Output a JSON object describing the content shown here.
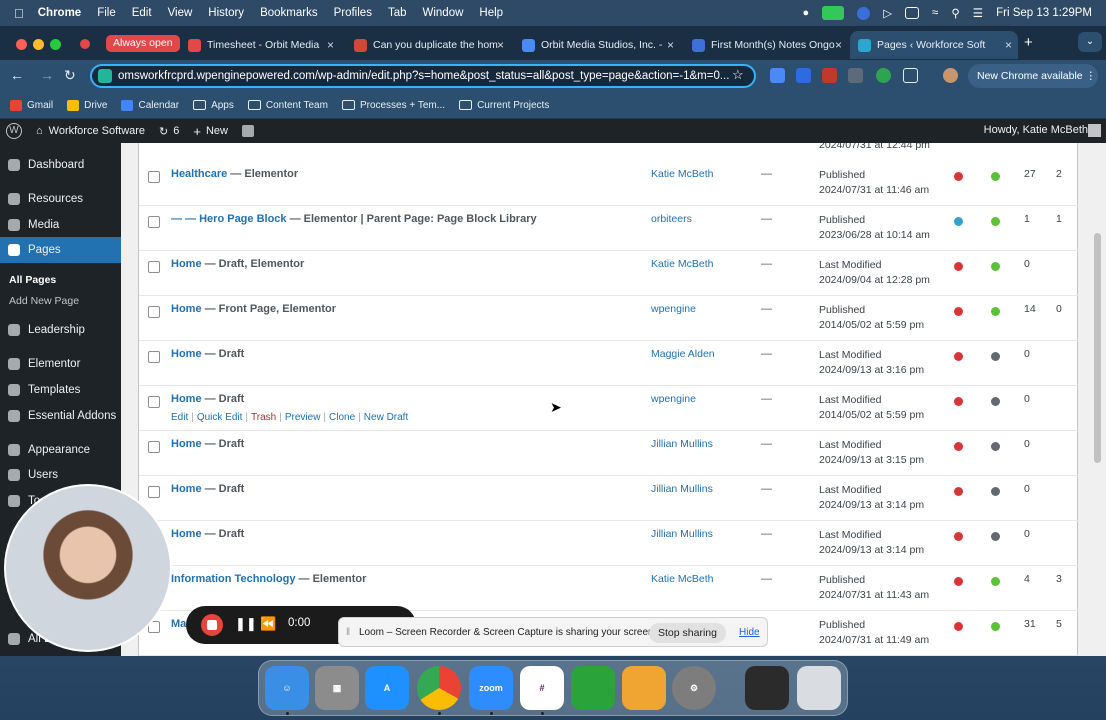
{
  "menubar": {
    "app": "Chrome",
    "items": [
      "File",
      "Edit",
      "View",
      "History",
      "Bookmarks",
      "Profiles",
      "Tab",
      "Window",
      "Help"
    ],
    "clock": "Fri Sep 13  1:29PM"
  },
  "tabs": {
    "pill": "Always open",
    "list": [
      {
        "label": "Timesheet - Orbit Media",
        "color": "#e34848"
      },
      {
        "label": "Can you duplicate the hom",
        "color": "#d44638"
      },
      {
        "label": "Orbit Media Studios, Inc. -",
        "color": "#4a8af4"
      },
      {
        "label": "First Month(s) Notes Ongo",
        "color": "#3f6fd8"
      },
      {
        "label": "Pages ‹ Workforce Soft",
        "color": "#2ba6cf"
      }
    ]
  },
  "toolbar": {
    "url": "omsworkfrcprd.wpenginepowered.com/wp-admin/edit.php?s=home&post_status=all&post_type=page&action=-1&m=0...",
    "new_chrome": "New Chrome available"
  },
  "bookmarks": [
    {
      "label": "Gmail",
      "kind": "icon",
      "color": "#ea4335"
    },
    {
      "label": "Drive",
      "kind": "icon",
      "color": "#fbbc04"
    },
    {
      "label": "Calendar",
      "kind": "icon",
      "color": "#4285f4"
    },
    {
      "label": "Apps",
      "kind": "folder"
    },
    {
      "label": "Content Team",
      "kind": "folder"
    },
    {
      "label": "Processes + Tem...",
      "kind": "folder"
    },
    {
      "label": "Current Projects",
      "kind": "folder"
    }
  ],
  "wpbar": {
    "site": "Workforce Software",
    "updates": "6",
    "new": "New",
    "howdy": "Howdy, Katie McBeth"
  },
  "sidebar": {
    "items": [
      {
        "label": "Dashboard"
      },
      {
        "label": "Resources"
      },
      {
        "label": "Media"
      },
      {
        "label": "Pages"
      },
      {
        "label": "Leadership"
      },
      {
        "label": "Elementor"
      },
      {
        "label": "Templates"
      },
      {
        "label": "Essential Addons"
      },
      {
        "label": "Appearance"
      },
      {
        "label": "Users"
      },
      {
        "label": "To"
      },
      {
        "label": "All E"
      }
    ],
    "sub": [
      "All Pages",
      "Add New Page"
    ]
  },
  "top_date": "2024/07/31 at 12:44 pm",
  "rows": [
    {
      "title": "Healthcare",
      "suffix": " — Elementor",
      "author": "Katie McBeth",
      "comments": "—",
      "status": "Published",
      "date": "2024/07/31 at 11:46 am",
      "c1": "#d63638",
      "c2": "#5bc236",
      "n1": "27",
      "n2": "2"
    },
    {
      "title": "— — Hero Page Block",
      "suffix": " — Elementor | Parent Page: Page Block Library",
      "author": "orbiteers",
      "comments": "—",
      "status": "Published",
      "date": "2023/06/28 at 10:14 am",
      "c1": "#2ea2cc",
      "c2": "#5bc236",
      "n1": "1",
      "n2": "1"
    },
    {
      "title": "Home",
      "suffix": " — Draft, Elementor",
      "author": "Katie McBeth",
      "comments": "—",
      "status": "Last Modified",
      "date": "2024/09/04 at 12:28 pm",
      "c1": "#d63638",
      "c2": "#5bc236",
      "n1": "0",
      "n2": ""
    },
    {
      "title": "Home",
      "suffix": " — Front Page, Elementor",
      "author": "wpengine",
      "comments": "—",
      "status": "Published",
      "date": "2014/05/02 at 5:59 pm",
      "c1": "#d63638",
      "c2": "#5bc236",
      "n1": "14",
      "n2": "0"
    },
    {
      "title": "Home",
      "suffix": " — Draft",
      "author": "Maggie Alden",
      "comments": "—",
      "status": "Last Modified",
      "date": "2024/09/13 at 3:16 pm",
      "c1": "#d63638",
      "c2": "#646970",
      "n1": "0",
      "n2": ""
    },
    {
      "title": "Home",
      "suffix": " — Draft",
      "author": "wpengine",
      "comments": "—",
      "status": "Last Modified",
      "date": "2014/05/02 at 5:59 pm",
      "c1": "#d63638",
      "c2": "#646970",
      "n1": "0",
      "n2": "",
      "actions": [
        "Edit",
        "Quick Edit",
        "Trash",
        "Preview",
        "Clone",
        "New Draft"
      ]
    },
    {
      "title": "Home",
      "suffix": " — Draft",
      "author": "Jillian Mullins",
      "comments": "—",
      "status": "Last Modified",
      "date": "2024/09/13 at 3:15 pm",
      "c1": "#d63638",
      "c2": "#646970",
      "n1": "0",
      "n2": ""
    },
    {
      "title": "Home",
      "suffix": " — Draft",
      "author": "Jillian Mullins",
      "comments": "—",
      "status": "Last Modified",
      "date": "2024/09/13 at 3:14 pm",
      "c1": "#d63638",
      "c2": "#646970",
      "n1": "0",
      "n2": ""
    },
    {
      "title": "Home",
      "suffix": " — Draft",
      "author": "Jillian Mullins",
      "comments": "—",
      "status": "Last Modified",
      "date": "2024/09/13 at 3:14 pm",
      "c1": "#d63638",
      "c2": "#646970",
      "n1": "0",
      "n2": ""
    },
    {
      "title": "Information Technology",
      "suffix": " — Elementor",
      "author": "Katie McBeth",
      "comments": "—",
      "status": "Published",
      "date": "2024/07/31 at 11:43 am",
      "c1": "#d63638",
      "c2": "#5bc236",
      "n1": "4",
      "n2": "3"
    },
    {
      "title": "Ma",
      "suffix": "",
      "author": "",
      "comments": "",
      "status": "Published",
      "date": "2024/07/31 at 11:49 am",
      "c1": "#d63638",
      "c2": "#5bc236",
      "n1": "31",
      "n2": "5"
    }
  ],
  "loom": {
    "timer": "0:00",
    "share_text": "Loom – Screen Recorder & Screen Capture is sharing your screen.",
    "stop": "Stop sharing",
    "hide": "Hide"
  },
  "dock": [
    {
      "name": "Finder",
      "color": "#3a8ee6"
    },
    {
      "name": "Launchpad",
      "color": "#8c8c8c"
    },
    {
      "name": "App Store",
      "color": "#1e90ff"
    },
    {
      "name": "Chrome",
      "color": "#e9e9e9"
    },
    {
      "name": "zoom",
      "color": "#2d8cff"
    },
    {
      "name": "Slack",
      "color": "#ffffff"
    },
    {
      "name": "Gecko",
      "color": "#2aa33b"
    },
    {
      "name": "Pages",
      "color": "#f0a431"
    },
    {
      "name": "Settings",
      "color": "#7d7d7d"
    },
    {
      "name": "Window",
      "color": "#2b2b2b"
    },
    {
      "name": "Trash",
      "color": "#d9dde2"
    }
  ]
}
